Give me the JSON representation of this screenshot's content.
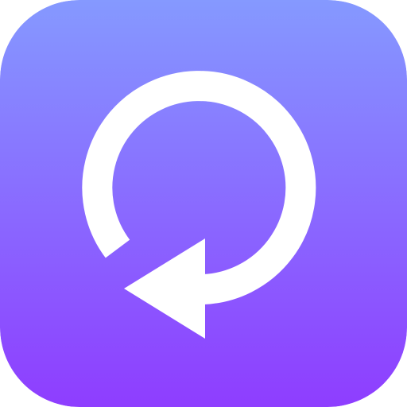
{
  "app_icon": {
    "icon": "rotate-left-icon",
    "colors": {
      "gradient_top": "#8599FF",
      "gradient_bottom": "#8E3DFF",
      "glyph": "#FFFFFF"
    }
  }
}
